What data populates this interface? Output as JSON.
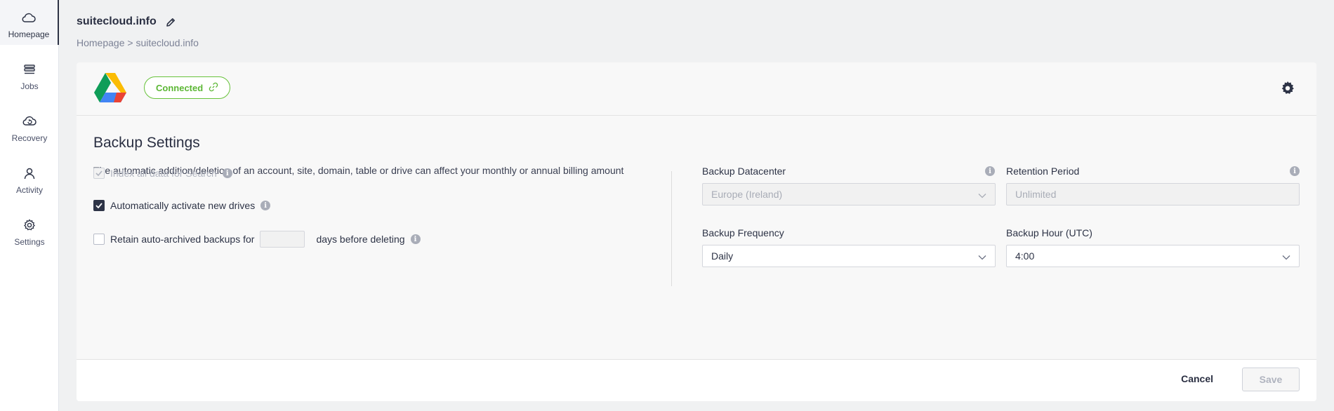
{
  "sidebar": {
    "items": [
      {
        "label": "Homepage",
        "icon": "cloud-icon",
        "active": true
      },
      {
        "label": "Jobs",
        "icon": "list-icon"
      },
      {
        "label": "Recovery",
        "icon": "cloud-recovery-icon"
      },
      {
        "label": "Activity",
        "icon": "user-icon"
      },
      {
        "label": "Settings",
        "icon": "gear-icon"
      }
    ]
  },
  "header": {
    "title": "suitecloud.info",
    "breadcrumb": "Homepage > suitecloud.info"
  },
  "connection": {
    "status": "Connected",
    "status_color": "#5cb735"
  },
  "backup": {
    "title": "Backup Settings",
    "description": "The automatic addition/deletion of an account, site, domain, table or drive can affect your monthly or annual billing amount",
    "options": {
      "index_label": "Index all data for Search",
      "auto_activate_label": "Automatically activate new drives",
      "retain_label": "Retain auto-archived backups for",
      "retain_suffix": "days before deleting",
      "retain_days": ""
    },
    "fields": {
      "datacenter_label": "Backup Datacenter",
      "datacenter_value": "Europe (Ireland)",
      "retention_label": "Retention Period",
      "retention_value": "Unlimited",
      "frequency_label": "Backup Frequency",
      "frequency_value": "Daily",
      "hour_label": "Backup Hour (UTC)",
      "hour_value": "4:00"
    }
  },
  "footer": {
    "cancel_label": "Cancel",
    "save_label": "Save"
  },
  "colors": {
    "accent": "#2d3346",
    "connected": "#67c23a"
  }
}
